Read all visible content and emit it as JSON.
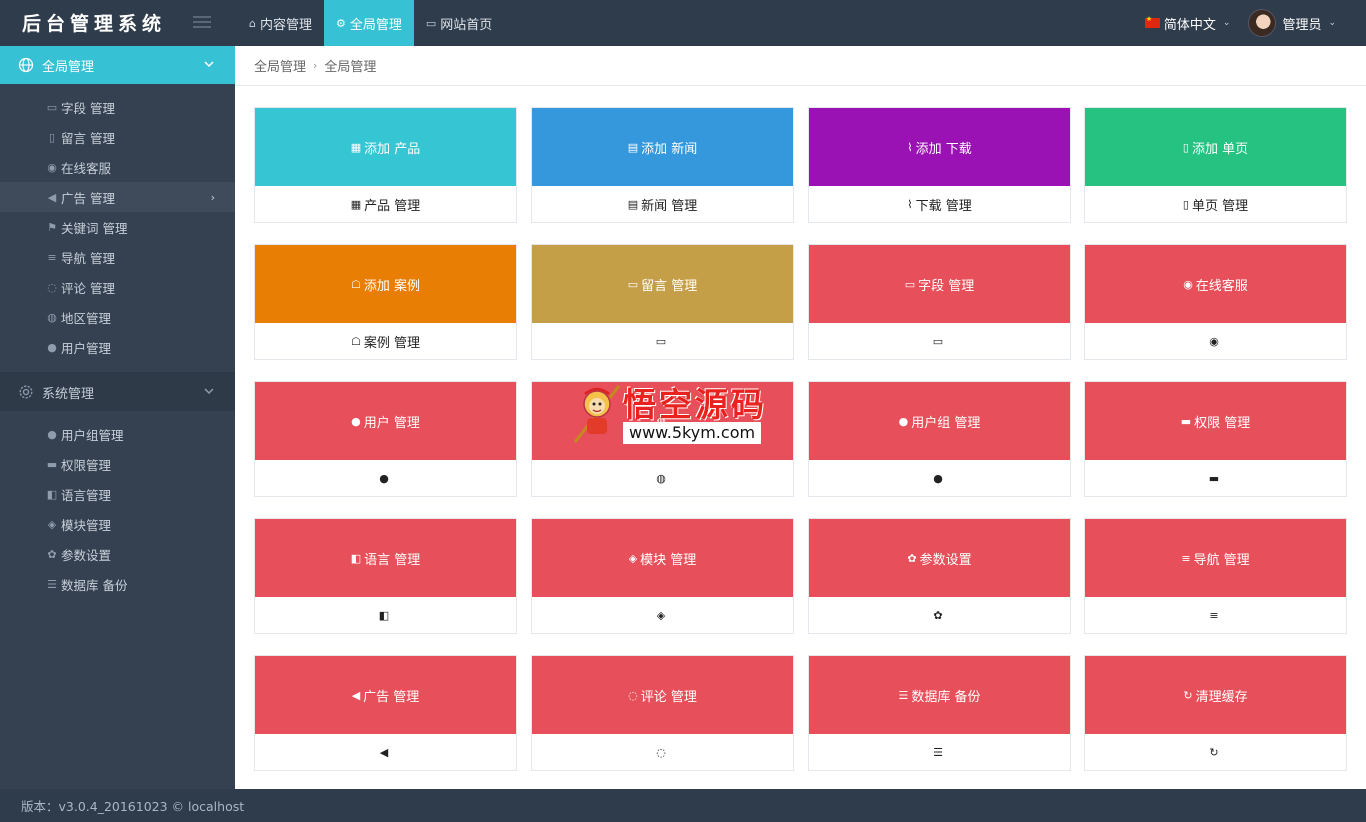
{
  "app": {
    "title": "后台管理系统"
  },
  "topnav": [
    {
      "icon": "home-icon",
      "label": "内容管理"
    },
    {
      "icon": "gear-icon",
      "label": "全局管理"
    },
    {
      "icon": "monitor-icon",
      "label": "网站首页"
    }
  ],
  "language": {
    "label": "简体中文"
  },
  "user": {
    "name": "管理员"
  },
  "sidebar": {
    "section1": {
      "label": "全局管理",
      "items": [
        {
          "label": "字段 管理",
          "icon": "list-alt-icon"
        },
        {
          "label": "留言 管理",
          "icon": "tablet-icon"
        },
        {
          "label": "在线客服",
          "icon": "comments-icon"
        },
        {
          "label": "广告 管理",
          "icon": "bullhorn-icon"
        },
        {
          "label": "关键词 管理",
          "icon": "flag-icon"
        },
        {
          "label": "导航 管理",
          "icon": "bars-icon"
        },
        {
          "label": "评论 管理",
          "icon": "comment-icon"
        },
        {
          "label": "地区管理",
          "icon": "map-marker-icon"
        },
        {
          "label": "用户管理",
          "icon": "user-icon"
        }
      ]
    },
    "section2": {
      "label": "系统管理",
      "items": [
        {
          "label": "用户组管理",
          "icon": "users-icon"
        },
        {
          "label": "权限管理",
          "icon": "briefcase-icon"
        },
        {
          "label": "语言管理",
          "icon": "language-icon"
        },
        {
          "label": "模块管理",
          "icon": "cubes-icon"
        },
        {
          "label": "参数设置",
          "icon": "cogs-icon"
        },
        {
          "label": "数据库 备份",
          "icon": "database-icon"
        }
      ]
    }
  },
  "breadcrumb": [
    "全局管理",
    "全局管理"
  ],
  "cards": [
    {
      "tile": "添加 产品",
      "foot": "产品 管理",
      "color": "#36c6d3",
      "icon": "th-large-icon",
      "glyph": "▦"
    },
    {
      "tile": "添加 新闻",
      "foot": "新闻 管理",
      "color": "#3598dc",
      "icon": "book-icon",
      "glyph": "▤"
    },
    {
      "tile": "添加 下载",
      "foot": "下载 管理",
      "color": "#9a12b3",
      "icon": "paperclip-icon",
      "glyph": "⌇"
    },
    {
      "tile": "添加 单页",
      "foot": "单页 管理",
      "color": "#26c281",
      "icon": "file-icon",
      "glyph": "▯"
    },
    {
      "tile": "添加 案例",
      "foot": "案例 管理",
      "color": "#e87e04",
      "icon": "users-outline-icon",
      "glyph": "☖"
    },
    {
      "tile": "留言 管理",
      "foot": "",
      "color": "#c49f47",
      "icon": "list-alt-icon",
      "glyph": "▭"
    },
    {
      "tile": "字段 管理",
      "foot": "",
      "color": "#e7505a",
      "icon": "list-alt-icon",
      "glyph": "▭"
    },
    {
      "tile": "在线客服",
      "foot": "",
      "color": "#e7505a",
      "icon": "comments-icon",
      "glyph": "◉"
    },
    {
      "tile": "用户 管理",
      "foot": "",
      "color": "#e7505a",
      "icon": "user-icon",
      "glyph": "●"
    },
    {
      "tile": "",
      "foot": "",
      "color": "#e7505a",
      "icon": "map-marker-icon",
      "glyph": "◍"
    },
    {
      "tile": "用户组 管理",
      "foot": "",
      "color": "#e7505a",
      "icon": "users-icon",
      "glyph": "●"
    },
    {
      "tile": "权限 管理",
      "foot": "",
      "color": "#e7505a",
      "icon": "briefcase-icon",
      "glyph": "▬"
    },
    {
      "tile": "语言 管理",
      "foot": "",
      "color": "#e7505a",
      "icon": "language-icon",
      "glyph": "◧"
    },
    {
      "tile": "模块 管理",
      "foot": "",
      "color": "#e7505a",
      "icon": "cubes-icon",
      "glyph": "◈"
    },
    {
      "tile": "参数设置",
      "foot": "",
      "color": "#e7505a",
      "icon": "cogs-icon",
      "glyph": "✿"
    },
    {
      "tile": "导航 管理",
      "foot": "",
      "color": "#e7505a",
      "icon": "bars-icon",
      "glyph": "≡"
    },
    {
      "tile": "广告 管理",
      "foot": "",
      "color": "#e7505a",
      "icon": "bullhorn-icon",
      "glyph": "◀"
    },
    {
      "tile": "评论 管理",
      "foot": "",
      "color": "#e7505a",
      "icon": "comment-icon",
      "glyph": "◌"
    },
    {
      "tile": "数据库 备份",
      "foot": "",
      "color": "#e7505a",
      "icon": "database-icon",
      "glyph": "☰"
    },
    {
      "tile": "清理缓存",
      "foot": "",
      "color": "#e7505a",
      "icon": "refresh-icon",
      "glyph": "↻"
    }
  ],
  "watermark": {
    "title": "悟空源码",
    "url": "www.5kym.com"
  },
  "footer": {
    "text": "版本：v3.0.4_20161023 © localhost"
  }
}
